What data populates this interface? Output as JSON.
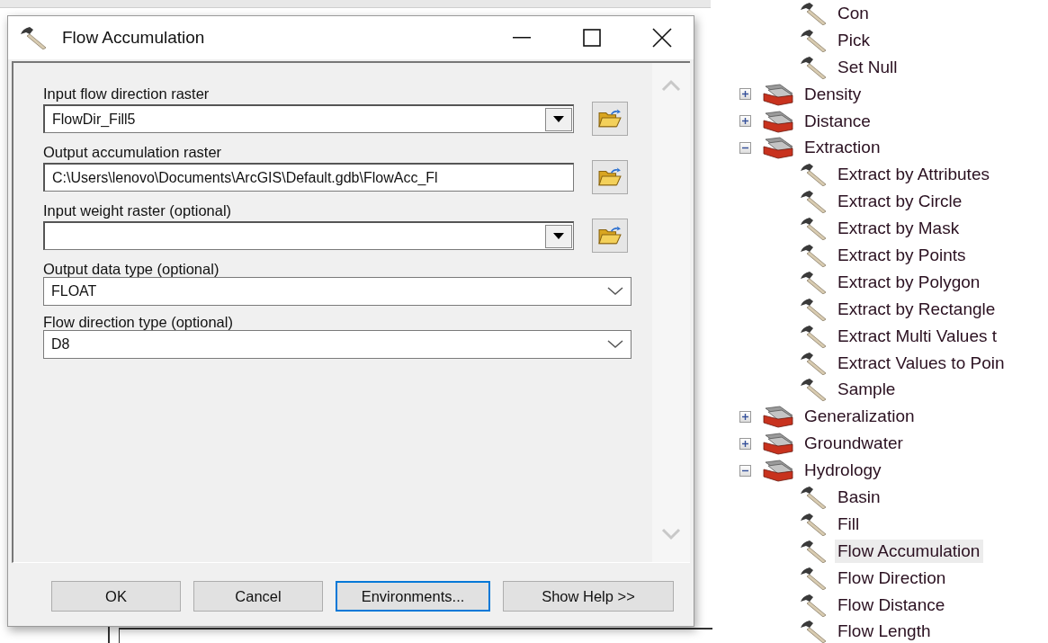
{
  "dialog": {
    "title": "Flow Accumulation",
    "params": [
      {
        "kind": "combo",
        "label": "Input flow direction raster",
        "value": "FlowDir_Fill5"
      },
      {
        "kind": "text",
        "label": "Output accumulation raster",
        "value": "C:\\Users\\lenovo\\Documents\\ArcGIS\\Default.gdb\\FlowAcc_Fl"
      },
      {
        "kind": "combo",
        "label": "Input weight raster (optional)"
      },
      {
        "kind": "select",
        "label": "Output data type (optional)",
        "value": "FLOAT"
      },
      {
        "kind": "select",
        "label": "Flow direction type (optional)",
        "value": "D8"
      }
    ],
    "buttons": [
      {
        "label": "OK",
        "focused": false
      },
      {
        "label": "Cancel",
        "focused": false
      },
      {
        "label": "Environments...",
        "focused": true
      },
      {
        "label": "Show Help >>",
        "focused": false
      }
    ]
  },
  "tree": [
    {
      "kind": "tool",
      "label": "Con",
      "selected": false
    },
    {
      "kind": "tool",
      "label": "Pick",
      "selected": false
    },
    {
      "kind": "tool",
      "label": "Set Null",
      "selected": false
    },
    {
      "kind": "toolset",
      "label": "Density",
      "expanded": false
    },
    {
      "kind": "toolset",
      "label": "Distance",
      "expanded": false
    },
    {
      "kind": "toolset",
      "label": "Extraction",
      "expanded": true,
      "children": [
        {
          "kind": "tool",
          "label": "Extract by Attributes",
          "selected": false
        },
        {
          "kind": "tool",
          "label": "Extract by Circle",
          "selected": false
        },
        {
          "kind": "tool",
          "label": "Extract by Mask",
          "selected": false
        },
        {
          "kind": "tool",
          "label": "Extract by Points",
          "selected": false
        },
        {
          "kind": "tool",
          "label": "Extract by Polygon",
          "selected": false
        },
        {
          "kind": "tool",
          "label": "Extract by Rectangle",
          "selected": false
        },
        {
          "kind": "tool",
          "label": "Extract Multi Values t",
          "selected": false
        },
        {
          "kind": "tool",
          "label": "Extract Values to Poin",
          "selected": false
        },
        {
          "kind": "tool",
          "label": "Sample",
          "selected": false
        }
      ]
    },
    {
      "kind": "toolset",
      "label": "Generalization",
      "expanded": false
    },
    {
      "kind": "toolset",
      "label": "Groundwater",
      "expanded": false
    },
    {
      "kind": "toolset",
      "label": "Hydrology",
      "expanded": true,
      "children": [
        {
          "kind": "tool",
          "label": "Basin",
          "selected": false
        },
        {
          "kind": "tool",
          "label": "Fill",
          "selected": false
        },
        {
          "kind": "tool",
          "label": "Flow Accumulation",
          "selected": true
        },
        {
          "kind": "tool",
          "label": "Flow Direction",
          "selected": false
        },
        {
          "kind": "tool",
          "label": "Flow Distance",
          "selected": false
        },
        {
          "kind": "tool",
          "label": "Flow Length",
          "selected": false
        }
      ]
    }
  ]
}
